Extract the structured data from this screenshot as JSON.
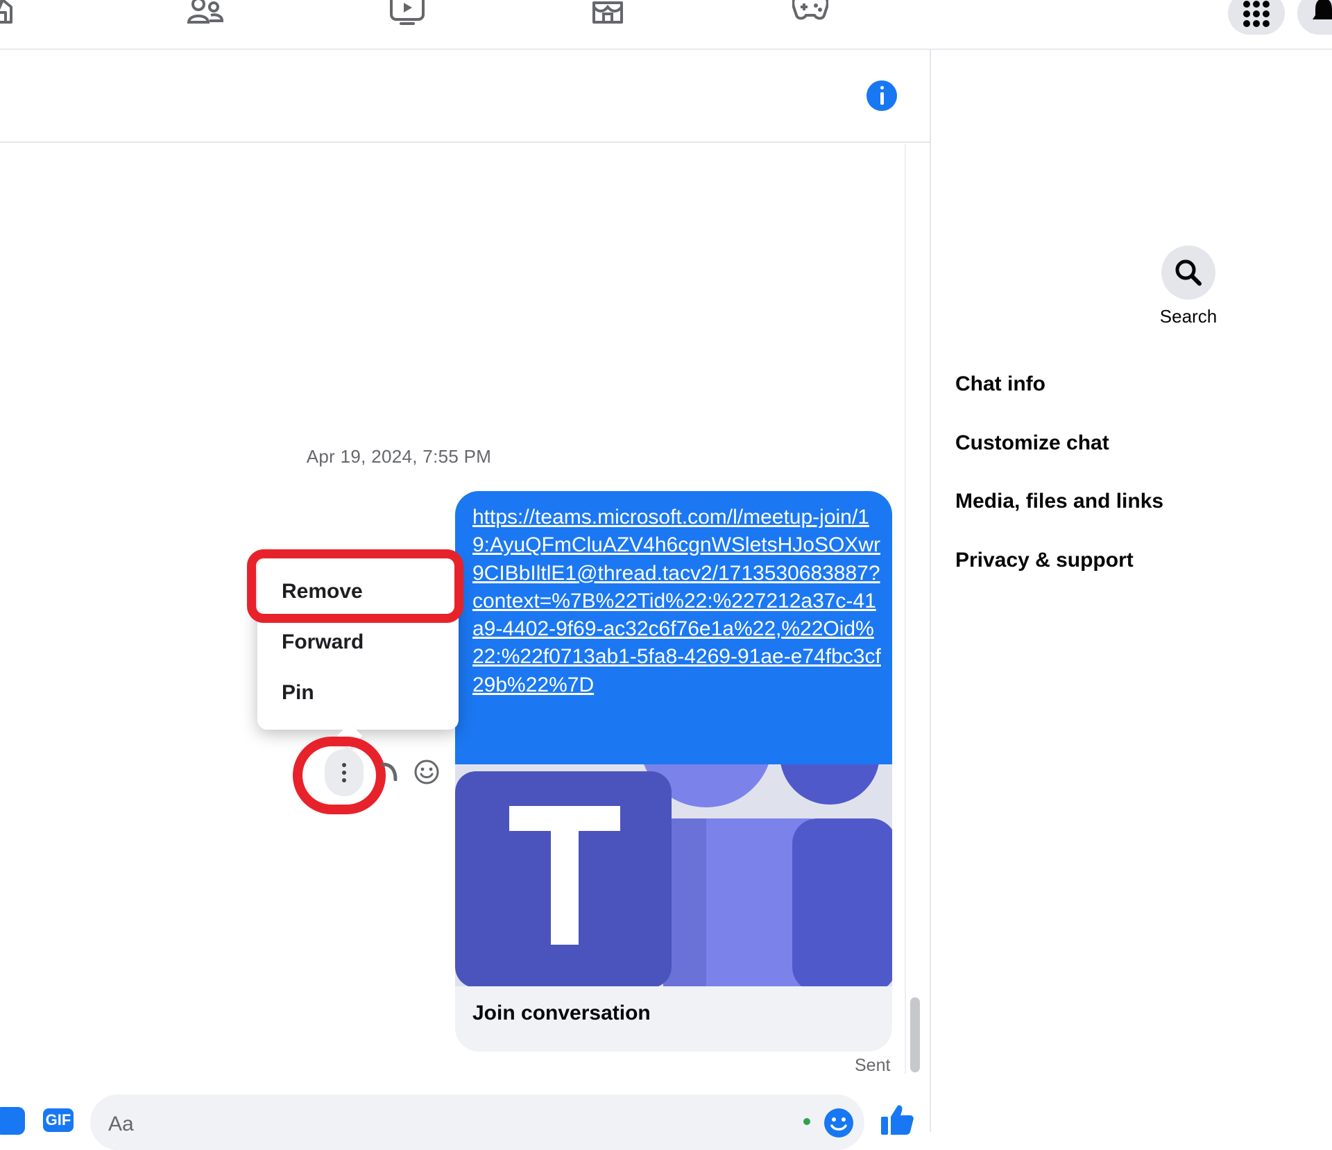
{
  "thread": {
    "timestamp": "Apr 19, 2024, 7:55 PM",
    "message": {
      "link_text": "https://teams.microsoft.com/l/meetup-join/19:AyuQFmCluAZV4h6cgnWSletsHJoSOXwr9CIBbIltlE1@thread.tacv2/1713530683887?context=%7B%22Tid%22:%227212a37c-41a9-4402-9f69-ac32c6f76e1a%22,%22Oid%22:%22f0713ab1-5fa8-4269-91ae-e74fbc3cf29b%22%7D",
      "preview_title": "Join conversation",
      "preview_image": "microsoft-teams-logo",
      "status": "Sent"
    }
  },
  "context_menu": {
    "items": [
      {
        "label": "Remove",
        "highlighted": true
      },
      {
        "label": "Forward",
        "highlighted": false
      },
      {
        "label": "Pin",
        "highlighted": false
      }
    ]
  },
  "message_actions": [
    "more-options-icon",
    "reply-icon",
    "react-icon"
  ],
  "composer": {
    "placeholder": "Aa",
    "gif_label": "GIF",
    "icons": [
      "sticker-icon",
      "gif-icon",
      "emoji-icon",
      "like-icon"
    ]
  },
  "top_nav": {
    "icons": [
      "home-icon",
      "friends-icon",
      "video-icon",
      "marketplace-icon",
      "gaming-icon",
      "menu-grid-icon",
      "notifications-icon"
    ]
  },
  "header": {
    "icons": [
      "info-icon"
    ]
  },
  "right_panel": {
    "search_label": "Search",
    "items": [
      "Chat info",
      "Customize chat",
      "Media, files and links",
      "Privacy & support"
    ]
  },
  "colors": {
    "accent": "#1877f2",
    "bubble": "#1b78f2",
    "highlight": "#e8222a",
    "teams_dark": "#4b53bc",
    "teams_light": "#7b83eb"
  }
}
